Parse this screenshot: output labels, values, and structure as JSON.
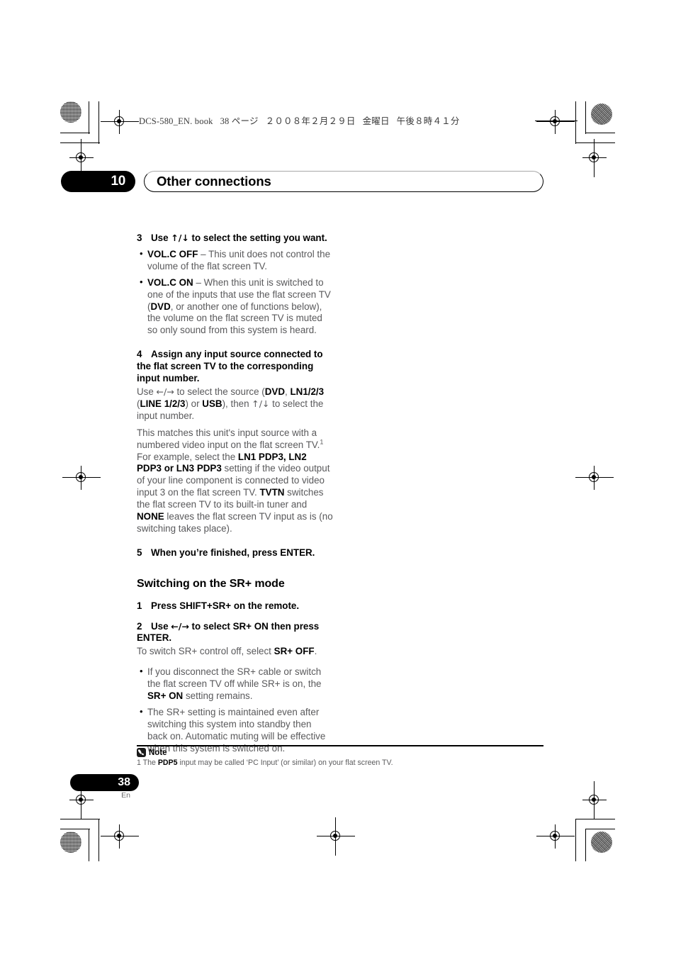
{
  "print_marks": {
    "filename_line": "DCS-580_EN. book   38 ページ   ２００８年２月２９日   金曜日   午後８時４１分"
  },
  "chapter": {
    "number": "10",
    "title": "Other connections"
  },
  "body": {
    "step3": {
      "num": "3",
      "text_prefix": "Use ",
      "arrows": "↑/↓",
      "text_suffix": " to select the setting you want.",
      "bullets": [
        {
          "term": "VOL.C OFF",
          "rest": " – This unit does not control the volume of the flat screen TV."
        },
        {
          "term": "VOL.C ON",
          "part1": " – When this unit is switched to one of the inputs that use the flat screen TV (",
          "term2": "DVD",
          "part2": ", or another one of functions below), the volume on the flat screen TV is muted so only sound from this system is heard."
        }
      ]
    },
    "step4": {
      "num": "4",
      "heading": "Assign any input source connected to the flat screen TV to the corresponding input number.",
      "line1_a": "Use ",
      "line1_arrows": "←/→",
      "line1_b": " to select the source (",
      "line1_dvd": "DVD",
      "line1_c": ", ",
      "line1_ln": "LN1/2/3",
      "line1_d": " (",
      "line1_line": "LINE 1/2/3",
      "line1_e": ") or ",
      "line1_usb": "USB",
      "line1_f": "), then ",
      "line1_arrows2": "↑/↓",
      "line1_g": " to select the input number.",
      "para_a": "This matches this unit's input source with a numbered video input on the flat screen TV.",
      "para_footnote": "1",
      "para_b": "For example, select the ",
      "para_bold1": "LN1 PDP3, LN2 PDP3 or LN3 PDP3",
      "para_c": " setting if the video output of your line component is connected to video input 3 on the flat screen TV. ",
      "para_bold2": "TVTN",
      "para_d": " switches the flat screen TV to its built-in tuner and ",
      "para_bold3": "NONE",
      "para_e": " leaves the flat screen TV input as is (no switching takes place)."
    },
    "step5": {
      "num": "5",
      "text": "When you’re finished, press ENTER."
    },
    "sr_section": {
      "heading": "Switching on the SR+ mode",
      "step1": {
        "num": "1",
        "text": "Press SHIFT+SR+ on the remote."
      },
      "step2": {
        "num": "2",
        "text_a": "Use ",
        "arrows": "←/→",
        "text_b": " to select SR+ ON then press ENTER."
      },
      "step2_sub_a": "To switch SR+ control off, select ",
      "step2_sub_bold": "SR+ OFF",
      "step2_sub_b": ".",
      "bullets": [
        {
          "part1": "If you disconnect the SR+ cable or switch the flat screen TV off while SR+ is on, the ",
          "bold": "SR+ ON",
          "part2": " setting remains."
        },
        {
          "part1": "The SR+ setting is maintained even after switching this system into standby then back on. Automatic muting will be effective when this system is switched on.",
          "bold": "",
          "part2": ""
        }
      ]
    }
  },
  "note": {
    "label": "Note",
    "icon": "pencil-note-icon",
    "text_a": "1 The ",
    "text_bold": "PDP5",
    "text_b": " input may be called ‘PC Input’ (or similar) on your flat screen TV."
  },
  "footer": {
    "page_number": "38",
    "language": "En"
  }
}
